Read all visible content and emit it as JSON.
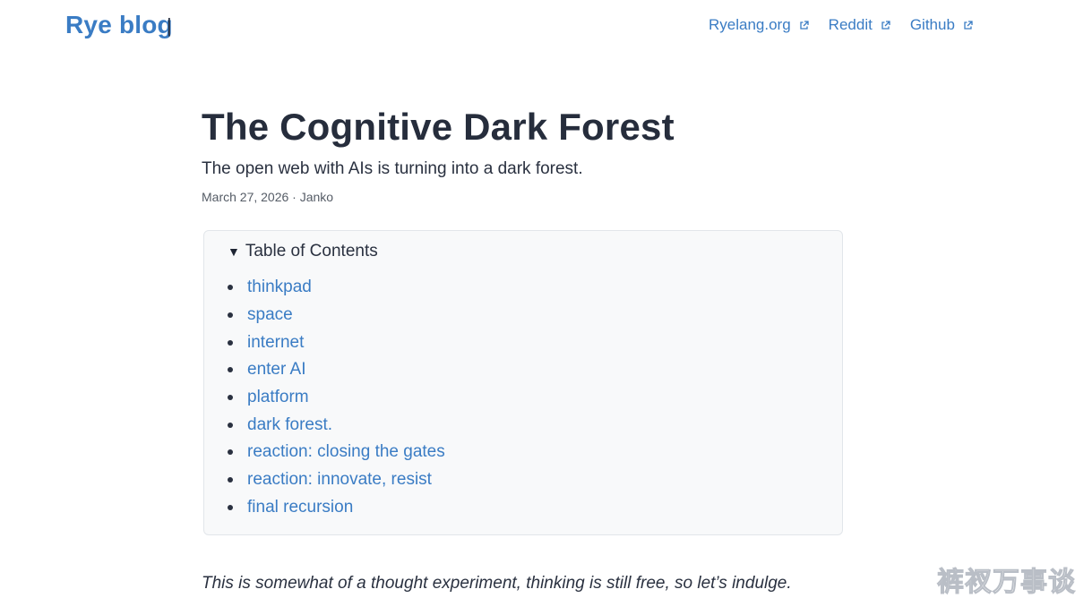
{
  "header": {
    "site_title": "Rye blog",
    "separator": "|",
    "nav": [
      {
        "label": "Ryelang.org",
        "icon": "external-link-icon"
      },
      {
        "label": "Reddit",
        "icon": "external-link-icon"
      },
      {
        "label": "Github",
        "icon": "external-link-icon"
      }
    ]
  },
  "post": {
    "title": "The Cognitive Dark Forest",
    "subtitle": "The open web with AIs is turning into a dark forest.",
    "meta": "March 27, 2026 · Janko",
    "intro": "This is somewhat of a thought experiment, thinking is still free, so let’s indulge."
  },
  "toc": {
    "caret": "▼",
    "summary": "Table of Contents",
    "items": [
      "thinkpad",
      "space",
      "internet",
      "enter AI",
      "platform",
      "dark forest.",
      "reaction: closing the gates",
      "reaction: innovate, resist",
      "final recursion"
    ]
  },
  "watermark": "裤衩万事谈",
  "colors": {
    "link": "#3a7cc4",
    "text": "#2a3140",
    "toc_bg": "#f8f9fa",
    "toc_border": "#e2e6ea"
  }
}
